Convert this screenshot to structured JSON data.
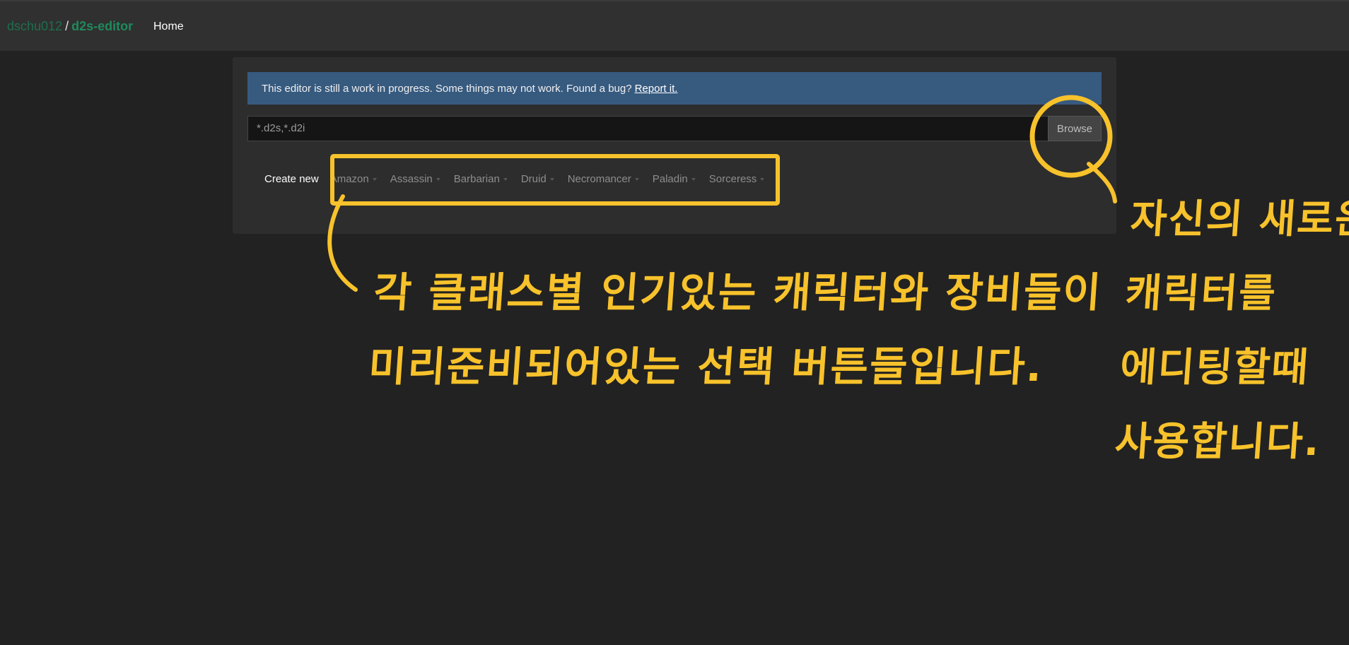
{
  "navbar": {
    "user": "dschu012",
    "separator": "/",
    "repo": "d2s-editor",
    "home": "Home"
  },
  "alert": {
    "message": "This editor is still a work in progress. Some things may not work. Found a bug?",
    "link": "Report it."
  },
  "file_input": {
    "placeholder": "*.d2s,*.d2i",
    "browse_label": "Browse"
  },
  "create": {
    "label": "Create new",
    "classes": [
      "Amazon",
      "Assassin",
      "Barbarian",
      "Druid",
      "Necromancer",
      "Paladin",
      "Sorceress"
    ]
  },
  "annotations": {
    "left_line1": "각 클래스별 인기있는 캐릭터와 장비들이",
    "left_line2": "미리준비되어있는 선택 버튼들입니다.",
    "right_line1": "자신의 새로운",
    "right_line2": "캐릭터를",
    "right_line3": "에디팅할때",
    "right_line4": "사용합니다."
  },
  "colors": {
    "background": "#222222",
    "navbar": "#303030",
    "alert": "#375a7f",
    "brand_green": "#1f8a5c",
    "annotation": "#f7c22b"
  }
}
